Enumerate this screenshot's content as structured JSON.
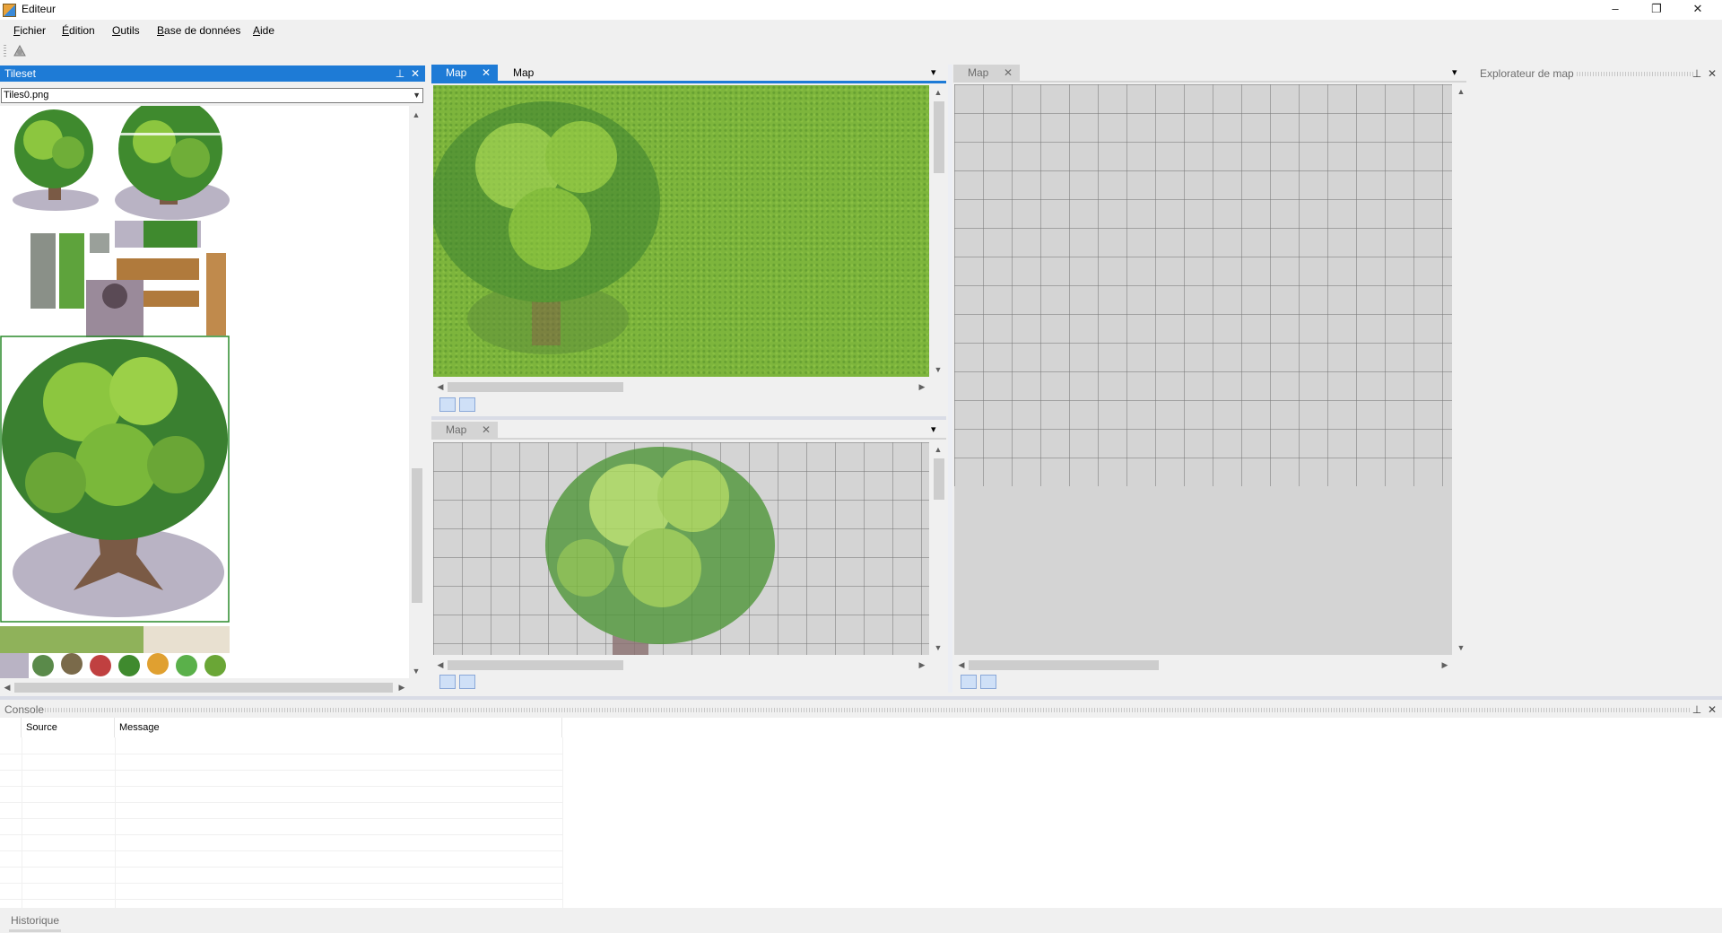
{
  "window": {
    "title": "Editeur",
    "minimize": "–",
    "maximize": "❐",
    "close": "✕"
  },
  "menu": [
    {
      "label": "Fichier",
      "hotkey": "F",
      "rest": "ichier"
    },
    {
      "label": "Édition",
      "hotkey": "É",
      "rest": "dition"
    },
    {
      "label": "Outils",
      "hotkey": "O",
      "rest": "utils"
    },
    {
      "label": "Base de données",
      "hotkey": "B",
      "rest": "ase de données"
    },
    {
      "label": "Aide",
      "hotkey": "A",
      "rest": "ide"
    }
  ],
  "toolbar": {
    "tool_icon": "tileset-tool-icon"
  },
  "tileset_panel": {
    "title": "Tileset",
    "pin": "⊥",
    "close": "✕",
    "selected_file": "Tiles0.png"
  },
  "map_docs": {
    "top_left_tabs": [
      {
        "label": "Map",
        "active": true
      },
      {
        "label": "Map",
        "active": false
      }
    ],
    "bottom_left_tab": "Map",
    "right_tab": "Map",
    "close": "✕",
    "dropdown": "▾"
  },
  "explorer_panel": {
    "title": "Explorateur de map",
    "pin": "⊥",
    "close": "✕"
  },
  "console_panel": {
    "title": "Console",
    "pin": "⊥",
    "close": "✕",
    "columns": [
      "Source",
      "Message"
    ]
  },
  "history_tab": {
    "label": "Historique"
  }
}
